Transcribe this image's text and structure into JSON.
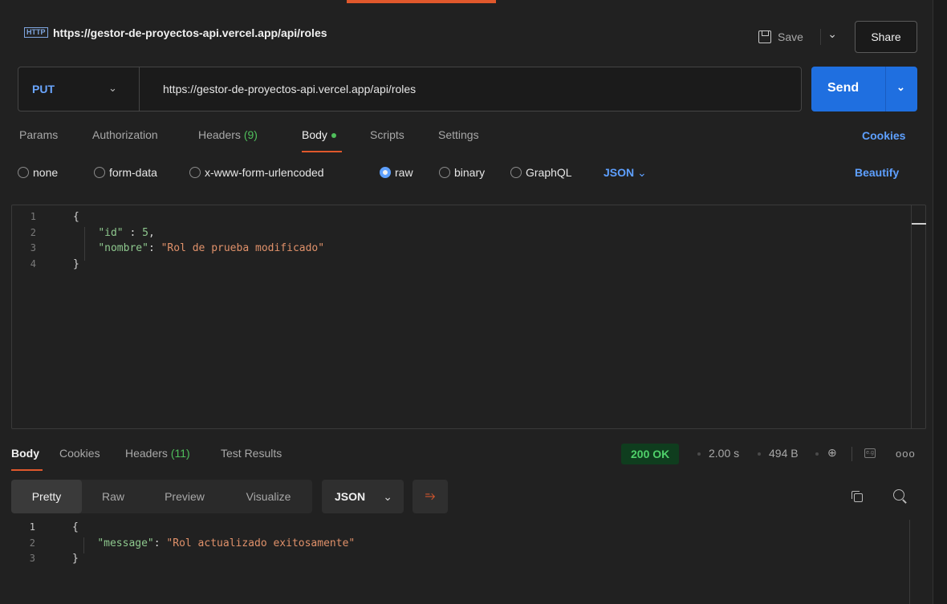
{
  "header": {
    "http_badge": "HTTP",
    "title": "https://gestor-de-proyectos-api.vercel.app/api/roles",
    "save_label": "Save",
    "share_label": "Share"
  },
  "request": {
    "method": "PUT",
    "url": "https://gestor-de-proyectos-api.vercel.app/api/roles",
    "send_label": "Send"
  },
  "request_tabs": {
    "params": "Params",
    "authorization": "Authorization",
    "headers": "Headers",
    "headers_count": "(9)",
    "body": "Body",
    "scripts": "Scripts",
    "settings": "Settings",
    "cookies": "Cookies"
  },
  "body_types": {
    "none": "none",
    "form_data": "form-data",
    "urlencoded": "x-www-form-urlencoded",
    "raw": "raw",
    "binary": "binary",
    "graphql": "GraphQL",
    "selected": "raw",
    "format": "JSON",
    "beautify": "Beautify"
  },
  "request_body": {
    "line_numbers": [
      "1",
      "2",
      "3",
      "4"
    ],
    "open_brace": "{",
    "key_id": "\"id\"",
    "sep_id": " : ",
    "val_id": "5",
    "comma": ",",
    "key_nombre": "\"nombre\"",
    "sep_nombre": ": ",
    "val_nombre": "\"Rol de prueba modificado\"",
    "close_brace": "}"
  },
  "response_tabs": {
    "body": "Body",
    "cookies": "Cookies",
    "headers": "Headers",
    "headers_count": "(11)",
    "test_results": "Test Results"
  },
  "response_meta": {
    "status": "200 OK",
    "time": "2.00 s",
    "size": "494 B"
  },
  "response_toolbar": {
    "pretty": "Pretty",
    "raw": "Raw",
    "preview": "Preview",
    "visualize": "Visualize",
    "format": "JSON"
  },
  "response_body": {
    "line_numbers": [
      "1",
      "2",
      "3"
    ],
    "open_brace": "{",
    "key_message": "\"message\"",
    "sep": ": ",
    "val_message": "\"Rol actualizado exitosamente\"",
    "close_brace": "}"
  },
  "colors": {
    "accent": "#e0582c",
    "primary": "#1f6fe0",
    "success": "#4fbf5b",
    "link": "#5ea0ff"
  }
}
